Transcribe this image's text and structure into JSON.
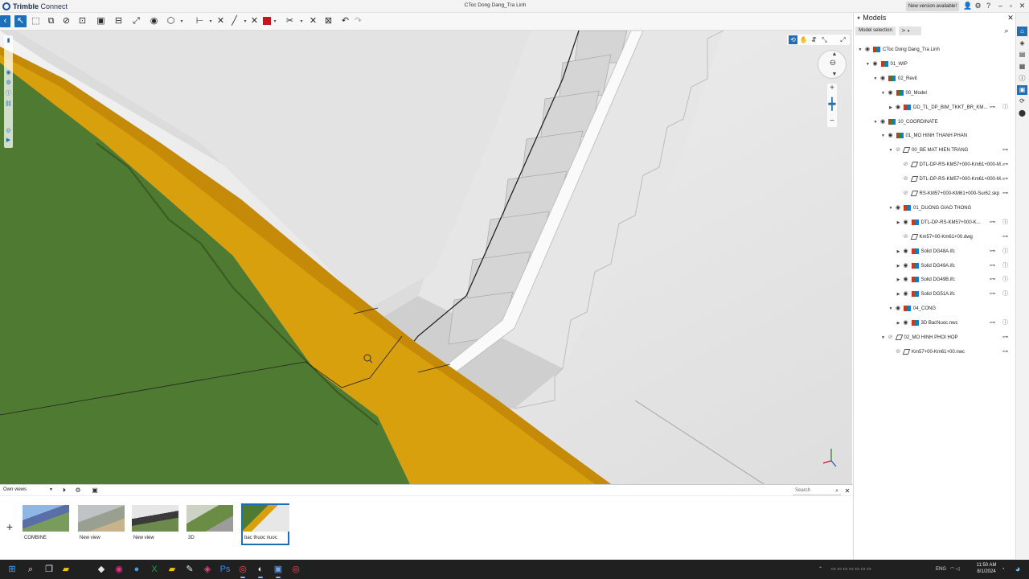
{
  "app": {
    "logo_text_bold": "Trimble",
    "logo_text": "Connect",
    "window_title": "CToc Dong Dang_Tra Linh",
    "new_version": "New version available!"
  },
  "panel": {
    "title": "Models",
    "model_selection": "Model selection",
    "tree": [
      {
        "label": "CToc Dong Dang_Tra Linh",
        "level": 0,
        "expand": "▼",
        "eye": true,
        "icon": "color"
      },
      {
        "label": "01_WIP",
        "level": 1,
        "expand": "▼",
        "eye": true,
        "icon": "color"
      },
      {
        "label": "02_Revit",
        "level": 2,
        "expand": "▼",
        "eye": true,
        "icon": "color"
      },
      {
        "label": "00_Model",
        "level": 3,
        "expand": "▼",
        "eye": true,
        "icon": "color"
      },
      {
        "label": "DD_TL_DP_BIM_TKKT_BR_KM...",
        "level": 4,
        "expand": "▶",
        "eye": true,
        "icon": "color",
        "actions": true
      },
      {
        "label": "10_COORDINATE",
        "level": 2,
        "expand": "▼",
        "eye": true,
        "icon": "color"
      },
      {
        "label": "01_MO HINH THANH PHAN",
        "level": 3,
        "expand": "▼",
        "eye": true,
        "icon": "color"
      },
      {
        "label": "00_BE MAT HIEN TRANG",
        "level": 4,
        "expand": "▼",
        "eye": false,
        "icon": "bw"
      },
      {
        "label": "DTL-DP-RS-KM57+000-Km61+000-M...",
        "level": 5,
        "expand": "",
        "eye": false,
        "icon": "bw",
        "link": true
      },
      {
        "label": "DTL-DP-RS-KM57+000-Km61+000-M...",
        "level": 5,
        "expand": "",
        "eye": false,
        "icon": "bw",
        "link": true
      },
      {
        "label": "RS-KM57+000-KM61+000-Sur62.skp",
        "level": 5,
        "expand": "",
        "eye": false,
        "icon": "bw",
        "link": true
      },
      {
        "label": "01_DUONG GIAO THONG",
        "level": 4,
        "expand": "▼",
        "eye": true,
        "icon": "color"
      },
      {
        "label": "DTL-DP-RS-KM57+000-K...",
        "level": 5,
        "expand": "▶",
        "eye": true,
        "icon": "color",
        "actions": true
      },
      {
        "label": "Km57+00-Km61+00.dwg",
        "level": 5,
        "expand": "",
        "eye": false,
        "icon": "bw"
      },
      {
        "label": "Solid DG48A.ifc",
        "level": 5,
        "expand": "▶",
        "eye": true,
        "icon": "color",
        "actions": true
      },
      {
        "label": "Solid DG49A.ifc",
        "level": 5,
        "expand": "▶",
        "eye": true,
        "icon": "color",
        "actions": true
      },
      {
        "label": "Solid DG49B.ifc",
        "level": 5,
        "expand": "▶",
        "eye": true,
        "icon": "color",
        "actions": true
      },
      {
        "label": "Solid DG51A.ifc",
        "level": 5,
        "expand": "▶",
        "eye": true,
        "icon": "color",
        "actions": true
      },
      {
        "label": "04_CONG",
        "level": 4,
        "expand": "▼",
        "eye": true,
        "icon": "color"
      },
      {
        "label": "3D BacNuoc.nwc",
        "level": 5,
        "expand": "▶",
        "eye": true,
        "icon": "color",
        "actions": true
      },
      {
        "label": "02_MO HINH PHOI HOP",
        "level": 3,
        "expand": "▼",
        "eye": false,
        "icon": "bw"
      },
      {
        "label": "Km57+00-Km61+00.nwc",
        "level": 4,
        "expand": "",
        "eye": false,
        "icon": "bw",
        "link": true
      }
    ]
  },
  "views": {
    "dropdown": "Own views",
    "search_placeholder": "Search",
    "items": [
      {
        "caption": "COMBINE",
        "selected": false,
        "theme": "blue"
      },
      {
        "caption": "New view",
        "selected": false,
        "theme": "grey"
      },
      {
        "caption": "New view",
        "selected": false,
        "theme": "dark"
      },
      {
        "caption": "3D",
        "selected": false,
        "theme": "green"
      },
      {
        "caption": "bac thuoc nuoc",
        "selected": true,
        "theme": "stairs"
      }
    ]
  },
  "taskbar": {
    "lang": "ENG",
    "time": "11:50 AM",
    "date": "8/1/2024"
  },
  "colors": {
    "accent": "#1c6fb8",
    "terrain": "#4f7a32",
    "road": "#d9a00d",
    "concrete": "#e2e2e2"
  }
}
